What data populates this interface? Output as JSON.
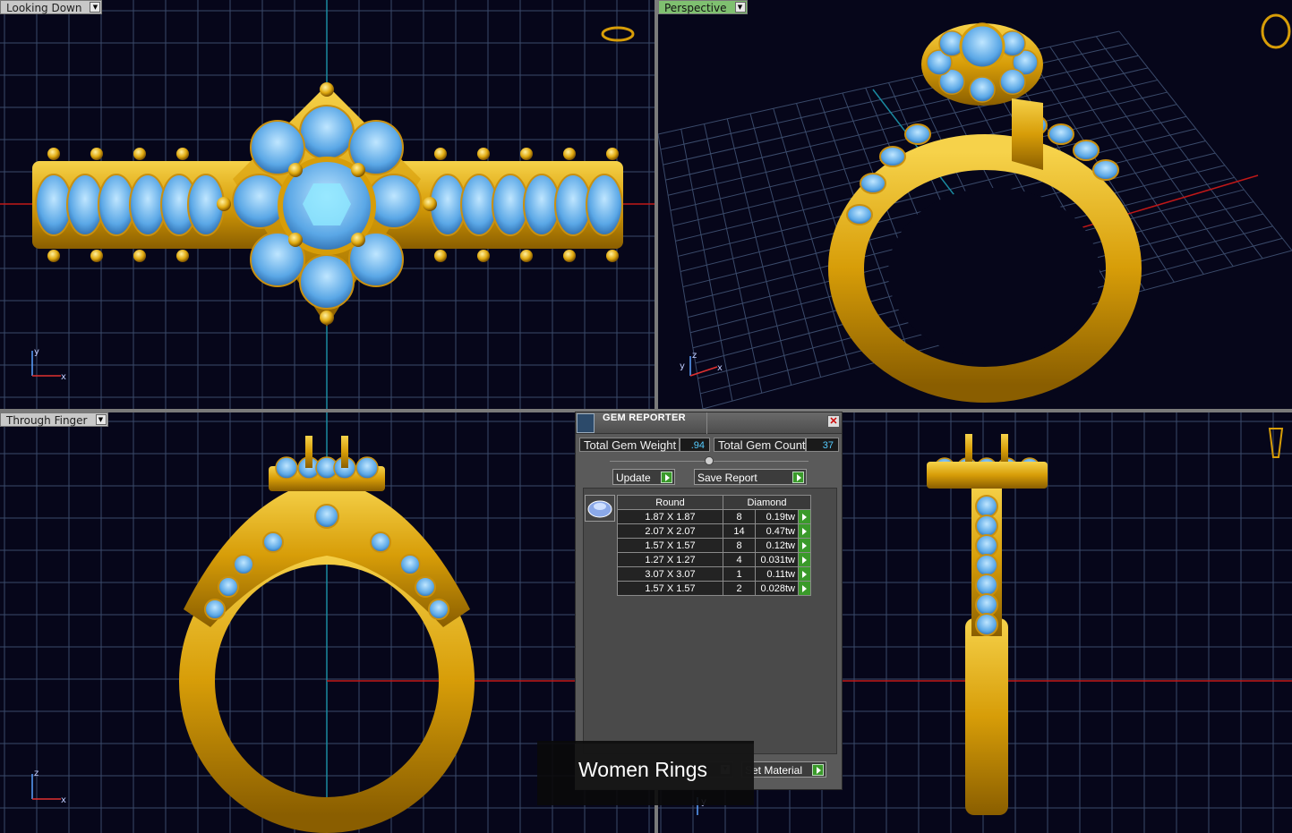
{
  "viewports": {
    "top_left": {
      "label": "Looking Down",
      "axes": [
        "y",
        "x"
      ]
    },
    "top_right": {
      "label": "Perspective",
      "axes": [
        "z",
        "y",
        "x"
      ]
    },
    "bottom_left": {
      "label": "Through Finger",
      "axes": [
        "z",
        "x"
      ]
    },
    "bottom_right": {
      "label": "",
      "axes": [
        "y"
      ]
    }
  },
  "gem_reporter": {
    "title": "GEM REPORTER",
    "total_weight_label": "Total Gem Weight",
    "total_weight_value": ".94",
    "total_count_label": "Total Gem Count",
    "total_count_value": "37",
    "update_label": "Update",
    "save_report_label": "Save Report",
    "table_headers": [
      "Round",
      "Diamond"
    ],
    "rows": [
      {
        "size": "1.87 X 1.87",
        "count": "8",
        "weight": "0.19tw"
      },
      {
        "size": "2.07 X 2.07",
        "count": "14",
        "weight": "0.47tw"
      },
      {
        "size": "1.57 X 1.57",
        "count": "8",
        "weight": "0.12tw"
      },
      {
        "size": "1.27 X 1.27",
        "count": "4",
        "weight": "0.031tw"
      },
      {
        "size": "3.07 X 3.07",
        "count": "1",
        "weight": "0.11tw"
      },
      {
        "size": "1.57 X 1.57",
        "count": "2",
        "weight": "0.028tw"
      }
    ],
    "set_material_label": "Set Material"
  },
  "caption": "Women Rings",
  "colors": {
    "viewport_bg": "#06061a",
    "grid": "#3a4a6a",
    "gold": "#e8b812",
    "gem": "#6fb6f0",
    "axis_red": "#c01818",
    "axis_cyan": "#1a8aa0",
    "go_button": "#3a9a2a"
  }
}
